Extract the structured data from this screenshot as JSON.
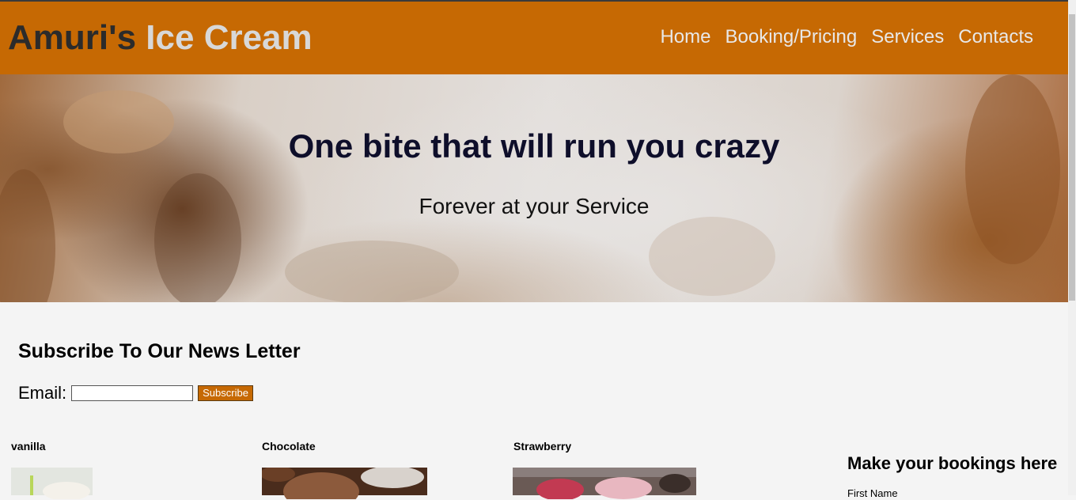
{
  "brand": {
    "part1": "Amuri's",
    "part2": "Ice Cream"
  },
  "nav": {
    "home": "Home",
    "booking": "Booking/Pricing",
    "services": "Services",
    "contacts": "Contacts"
  },
  "hero": {
    "title": "One bite that will run you crazy",
    "subtitle": "Forever at your Service"
  },
  "newsletter": {
    "title": "Subscribe To Our News Letter",
    "email_label": "Email:",
    "email_value": "",
    "button": "Subscribe"
  },
  "flavors": [
    {
      "name": "vanilla"
    },
    {
      "name": "Chocolate"
    },
    {
      "name": "Strawberry"
    }
  ],
  "booking": {
    "title": "Make your bookings here",
    "first_name_label": "First Name"
  },
  "colors": {
    "accent": "#c66903",
    "page_bg": "#f4f4f4",
    "brand_highlight": "#d8d8d8"
  }
}
